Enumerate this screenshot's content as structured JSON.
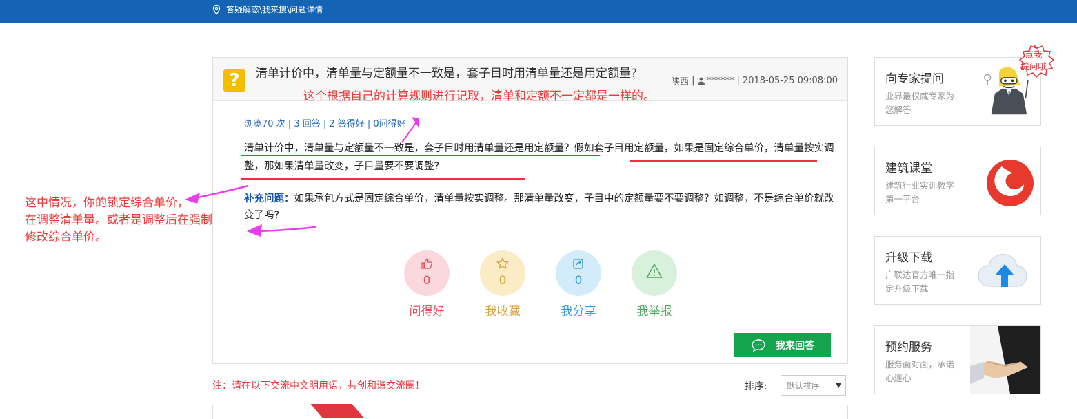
{
  "breadcrumb": {
    "parts": [
      "答疑解惑",
      "\\我来搜",
      "\\问题详情"
    ]
  },
  "question": {
    "title": "清单计价中，清单量与定额量不一致是，套子目时用清单量还是用定额量?",
    "region": "陕西",
    "user": "******",
    "datetime": "2018-05-25 09:08:00",
    "stats": "浏览70 次 | 3 回答 | 2 答得好 | 0问得好",
    "body": "清单计价中，清单量与定额量不一致是，套子目时用清单量还是用定额量？假如套子目用定额量，如果是固定综合单价，清单量按实调整，那如果清单量改变，子目量要不要调整?",
    "supplement_label": "补充问题：",
    "supplement_text": "如果承包方式是固定综合单价，清单量按实调整。那清单量改变，子目中的定额量要不要调整？如调整，不是综合单价就改变了吗?"
  },
  "actions": [
    {
      "label": "问得好",
      "count": "0",
      "icon": "thumbs-up-icon",
      "bg": "#fbd8dd",
      "color": "#e0515c"
    },
    {
      "label": "我收藏",
      "count": "0",
      "icon": "star-icon",
      "bg": "#fbecc6",
      "color": "#d8a13a"
    },
    {
      "label": "我分享",
      "count": "0",
      "icon": "share-icon",
      "bg": "#d3ecfa",
      "color": "#3a9ad9"
    },
    {
      "label": "我举报",
      "count": "",
      "icon": "warning-icon",
      "bg": "#d8f1dd",
      "color": "#4fa860"
    }
  ],
  "answer_button": "我来回答",
  "notice": "注：请在以下交流中文明用语，共创和谐交流圈！",
  "sort": {
    "label": "排序:",
    "selected": "默认排序"
  },
  "sidebar": {
    "badge": "点我\n提问哦",
    "cards": [
      {
        "title": "向专家提问",
        "sub": "业界最权威专家为您解答"
      },
      {
        "title": "建筑课堂",
        "sub": "建筑行业实训教学第一平台"
      },
      {
        "title": "升级下载",
        "sub": "广联达官方唯一指定升级下载"
      },
      {
        "title": "预约服务",
        "sub": "服务面对面，承诺心连心"
      }
    ]
  },
  "annotations": {
    "a1": "这个根据自己的计算规则进行记取，清单和定额不一定都是一样的。",
    "a2_line1": "这中情况，你的锁定综合单价，",
    "a2_line2": "在调整清单量。或者是调整后在强制",
    "a2_line3": "修改综合单价。"
  },
  "colors": {
    "topbar": "#1564b4",
    "accent_green": "#14a44e",
    "annotation_red": "#f03a3a",
    "arrow_magenta": "#e93cf0"
  }
}
